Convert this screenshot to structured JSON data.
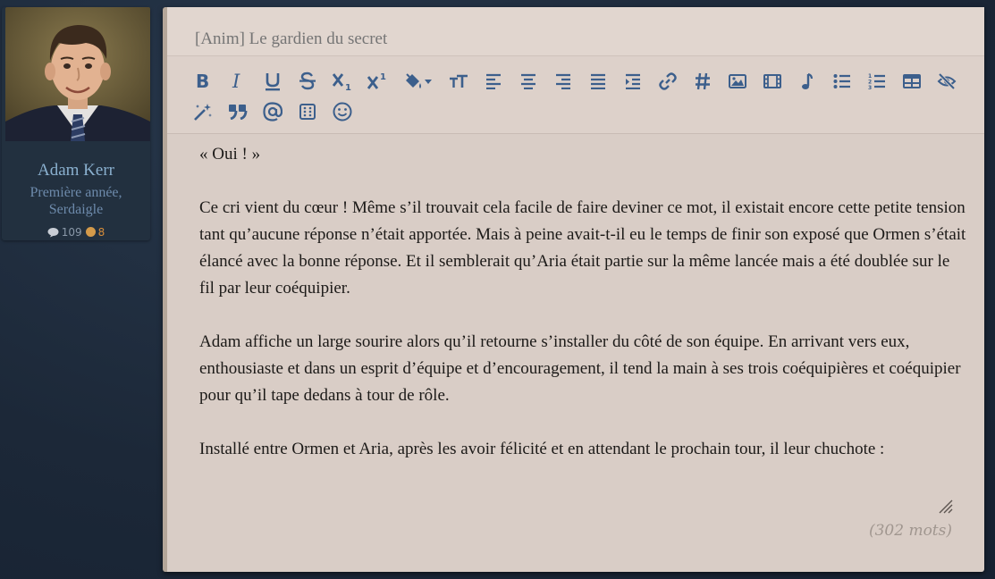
{
  "profile": {
    "name": "Adam Kerr",
    "rank_line1": "Première année,",
    "rank_line2": "Serdaigle",
    "posts": "109",
    "points": "8"
  },
  "editor": {
    "title_placeholder": "[Anim] Le gardien du secret",
    "toolbar_row1": [
      "bold-icon",
      "italic-icon",
      "underline-icon",
      "strikethrough-icon",
      "subscript-icon",
      "superscript-icon",
      "fill-color-icon",
      "font-size-icon",
      "align-left-icon",
      "align-center-icon",
      "align-right-icon",
      "align-justify-icon",
      "indent-icon",
      "link-icon",
      "hashtag-icon",
      "image-icon",
      "video-icon",
      "music-icon",
      "bullet-list-icon",
      "numbered-list-icon",
      "table-icon",
      "hide-icon"
    ],
    "toolbar_row2": [
      "magic-wand-icon",
      "quote-icon",
      "mention-icon",
      "dice-icon",
      "emoji-icon"
    ],
    "paragraphs": [
      "« Oui ! »",
      "Ce cri vient du cœur ! Même s’il trouvait cela facile de faire deviner ce mot, il existait encore cette petite tension tant qu’aucune réponse n’était apportée. Mais à peine avait-t-il eu le temps de finir son exposé que Ormen s’était élancé avec la bonne réponse. Et il semblerait qu’Aria était partie sur la même lancée mais a été doublée sur le fil par leur coéquipier.",
      "Adam affiche un large sourire alors qu’il retourne s’installer du côté de son équipe. En arrivant vers eux, enthousiaste et dans un esprit d’équipe et d’encouragement, il tend la main à ses trois coéquipières et coéquipier pour qu’il tape dedans à tour de rôle.",
      "Installé entre Ormen et Aria, après les avoir félicité et en attendant le prochain tour, il leur chuchote :"
    ],
    "word_count": "(302 mots)"
  },
  "colors": {
    "accent": "#3c5f8c",
    "panel": "#d9cdc6",
    "background": "#1f2c3d",
    "name": "#8ab0cf"
  }
}
